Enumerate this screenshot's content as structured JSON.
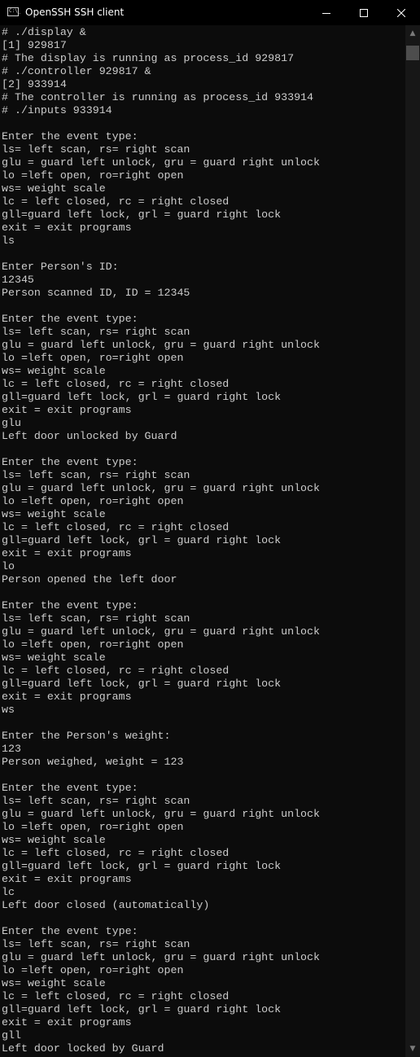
{
  "window": {
    "title": "OpenSSH SSH client",
    "app_icon": "console-icon",
    "app_icon_text": "C:\\_"
  },
  "terminal": {
    "lines": [
      "# ./display &",
      "[1] 929817",
      "# The display is running as process_id 929817",
      "# ./controller 929817 &",
      "[2] 933914",
      "# The controller is running as process_id 933914",
      "# ./inputs 933914",
      "",
      "Enter the event type:",
      "ls= left scan, rs= right scan",
      "glu = guard left unlock, gru = guard right unlock",
      "lo =left open, ro=right open",
      "ws= weight scale",
      "lc = left closed, rc = right closed",
      "gll=guard left lock, grl = guard right lock",
      "exit = exit programs",
      "ls",
      "",
      "Enter Person's ID:",
      "12345",
      "Person scanned ID, ID = 12345",
      "",
      "Enter the event type:",
      "ls= left scan, rs= right scan",
      "glu = guard left unlock, gru = guard right unlock",
      "lo =left open, ro=right open",
      "ws= weight scale",
      "lc = left closed, rc = right closed",
      "gll=guard left lock, grl = guard right lock",
      "exit = exit programs",
      "glu",
      "Left door unlocked by Guard",
      "",
      "Enter the event type:",
      "ls= left scan, rs= right scan",
      "glu = guard left unlock, gru = guard right unlock",
      "lo =left open, ro=right open",
      "ws= weight scale",
      "lc = left closed, rc = right closed",
      "gll=guard left lock, grl = guard right lock",
      "exit = exit programs",
      "lo",
      "Person opened the left door",
      "",
      "Enter the event type:",
      "ls= left scan, rs= right scan",
      "glu = guard left unlock, gru = guard right unlock",
      "lo =left open, ro=right open",
      "ws= weight scale",
      "lc = left closed, rc = right closed",
      "gll=guard left lock, grl = guard right lock",
      "exit = exit programs",
      "ws",
      "",
      "Enter the Person's weight:",
      "123",
      "Person weighed, weight = 123",
      "",
      "Enter the event type:",
      "ls= left scan, rs= right scan",
      "glu = guard left unlock, gru = guard right unlock",
      "lo =left open, ro=right open",
      "ws= weight scale",
      "lc = left closed, rc = right closed",
      "gll=guard left lock, grl = guard right lock",
      "exit = exit programs",
      "lc",
      "Left door closed (automatically)",
      "",
      "Enter the event type:",
      "ls= left scan, rs= right scan",
      "glu = guard left unlock, gru = guard right unlock",
      "lo =left open, ro=right open",
      "ws= weight scale",
      "lc = left closed, rc = right closed",
      "gll=guard left lock, grl = guard right lock",
      "exit = exit programs",
      "gll",
      "Left door locked by Guard"
    ]
  },
  "colors": {
    "background": "#0c0c0c",
    "text": "#cccccc",
    "titlebar": "#000000"
  }
}
